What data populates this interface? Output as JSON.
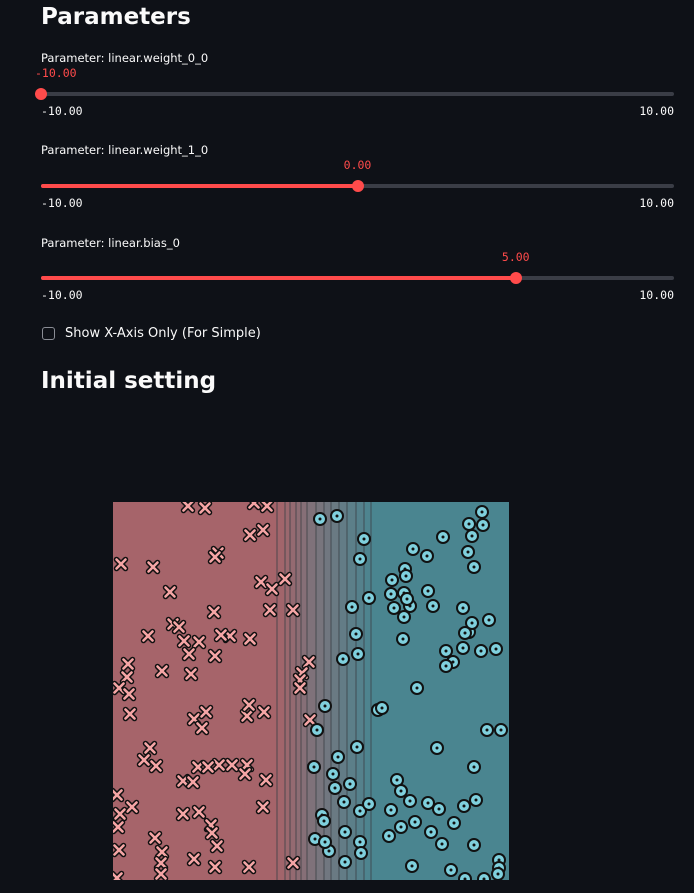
{
  "section_title": "Parameters",
  "sliders": [
    {
      "label": "Parameter: linear.weight_0_0",
      "value": -10.0,
      "value_text": "-10.00",
      "min_text": "-10.00",
      "max_text": "10.00",
      "min": -10,
      "max": 10
    },
    {
      "label": "Parameter: linear.weight_1_0",
      "value": 0.0,
      "value_text": "0.00",
      "min_text": "-10.00",
      "max_text": "10.00",
      "min": -10,
      "max": 10
    },
    {
      "label": "Parameter: linear.bias_0",
      "value": 5.0,
      "value_text": "5.00",
      "min_text": "-10.00",
      "max_text": "10.00",
      "min": -10,
      "max": 10
    }
  ],
  "checkbox": {
    "label": "Show X-Axis Only (For Simple)",
    "checked": false
  },
  "plot_title": "Initial setting",
  "colors": {
    "background": "#0e1117",
    "accent": "#ff4b4b",
    "class0_region": "#a6646a",
    "class1_region": "#4a8590",
    "class0_marker": "#f5a5a5",
    "class1_marker": "#7fd0dd"
  },
  "chart_data": {
    "type": "scatter",
    "title": "",
    "xlabel": "",
    "ylabel": "",
    "xlim": [
      0,
      396
    ],
    "ylim": [
      0,
      378
    ],
    "grid": false,
    "boundary_lines_x": [
      164,
      172,
      177,
      183,
      188,
      194,
      203,
      211,
      218,
      226,
      234,
      243,
      251,
      258
    ],
    "series": [
      {
        "marker": "x",
        "points": [
          [
            75,
            374
          ],
          [
            92,
            372
          ],
          [
            141,
            377
          ],
          [
            154,
            374
          ],
          [
            8,
            316
          ],
          [
            40,
            313
          ],
          [
            150,
            350
          ],
          [
            137,
            345
          ],
          [
            105,
            327
          ],
          [
            102,
            323
          ],
          [
            148,
            298
          ],
          [
            172,
            301
          ],
          [
            159,
            291
          ],
          [
            57,
            288
          ],
          [
            180,
            270
          ],
          [
            157,
            270
          ],
          [
            101,
            268
          ],
          [
            35,
            244
          ],
          [
            60,
            256
          ],
          [
            66,
            253
          ],
          [
            117,
            244
          ],
          [
            137,
            241
          ],
          [
            108,
            245
          ],
          [
            86,
            238
          ],
          [
            71,
            239
          ],
          [
            102,
            224
          ],
          [
            76,
            226
          ],
          [
            78,
            206
          ],
          [
            15,
            216
          ],
          [
            49,
            209
          ],
          [
            196,
            218
          ],
          [
            189,
            207
          ],
          [
            187,
            200
          ],
          [
            187,
            192
          ],
          [
            14,
            203
          ],
          [
            6,
            192
          ],
          [
            16,
            186
          ],
          [
            17,
            166
          ],
          [
            81,
            161
          ],
          [
            134,
            164
          ],
          [
            93,
            168
          ],
          [
            151,
            168
          ],
          [
            136,
            175
          ],
          [
            197,
            160
          ],
          [
            89,
            152
          ],
          [
            37,
            132
          ],
          [
            31,
            120
          ],
          [
            43,
            114
          ],
          [
            85,
            113
          ],
          [
            134,
            115
          ],
          [
            119,
            115
          ],
          [
            106,
            115
          ],
          [
            95,
            113
          ],
          [
            132,
            106
          ],
          [
            153,
            100
          ],
          [
            70,
            99
          ],
          [
            80,
            98
          ],
          [
            150,
            73
          ],
          [
            4,
            85
          ],
          [
            19,
            73
          ],
          [
            7,
            66
          ],
          [
            70,
            66
          ],
          [
            86,
            68
          ],
          [
            98,
            55
          ],
          [
            5,
            53
          ],
          [
            99,
            47
          ],
          [
            42,
            42
          ],
          [
            6,
            30
          ],
          [
            49,
            28
          ],
          [
            104,
            34
          ],
          [
            48,
            17
          ],
          [
            81,
            21
          ],
          [
            136,
            13
          ],
          [
            180,
            17
          ],
          [
            48,
            6
          ],
          [
            102,
            13
          ],
          [
            4,
            2
          ]
        ]
      },
      {
        "marker": "o",
        "points": [
          [
            207,
            361
          ],
          [
            224,
            364
          ],
          [
            251,
            341
          ],
          [
            247,
            321
          ],
          [
            292,
            311
          ],
          [
            314,
            324
          ],
          [
            330,
            343
          ],
          [
            359,
            344
          ],
          [
            370,
            355
          ],
          [
            369,
            368
          ],
          [
            356,
            356
          ],
          [
            355,
            328
          ],
          [
            361,
            313
          ],
          [
            300,
            331
          ],
          [
            315,
            289
          ],
          [
            293,
            304
          ],
          [
            256,
            282
          ],
          [
            239,
            273
          ],
          [
            278,
            286
          ],
          [
            279,
            300
          ],
          [
            291,
            287
          ],
          [
            297,
            274
          ],
          [
            294,
            281
          ],
          [
            281,
            272
          ],
          [
            320,
            274
          ],
          [
            291,
            263
          ],
          [
            350,
            272
          ],
          [
            356,
            248
          ],
          [
            290,
            241
          ],
          [
            352,
            247
          ],
          [
            359,
            257
          ],
          [
            350,
            232
          ],
          [
            376,
            260
          ],
          [
            243,
            246
          ],
          [
            368,
            229
          ],
          [
            383,
            231
          ],
          [
            245,
            226
          ],
          [
            230,
            221
          ],
          [
            333,
            229
          ],
          [
            340,
            218
          ],
          [
            333,
            214
          ],
          [
            304,
            192
          ],
          [
            212,
            174
          ],
          [
            265,
            170
          ],
          [
            269,
            172
          ],
          [
            374,
            150
          ],
          [
            388,
            150
          ],
          [
            204,
            150
          ],
          [
            324,
            132
          ],
          [
            244,
            133
          ],
          [
            225,
            123
          ],
          [
            201,
            113
          ],
          [
            361,
            113
          ],
          [
            220,
            106
          ],
          [
            237,
            96
          ],
          [
            284,
            100
          ],
          [
            288,
            89
          ],
          [
            297,
            79
          ],
          [
            222,
            92
          ],
          [
            247,
            69
          ],
          [
            231,
            78
          ],
          [
            209,
            65
          ],
          [
            315,
            77
          ],
          [
            326,
            71
          ],
          [
            302,
            58
          ],
          [
            351,
            74
          ],
          [
            363,
            80
          ],
          [
            256,
            76
          ],
          [
            211,
            59
          ],
          [
            232,
            48
          ],
          [
            202,
            41
          ],
          [
            247,
            38
          ],
          [
            361,
            35
          ],
          [
            386,
            20
          ],
          [
            386,
            12
          ],
          [
            338,
            10
          ],
          [
            352,
            1
          ],
          [
            276,
            44
          ],
          [
            288,
            53
          ],
          [
            341,
            57
          ],
          [
            318,
            48
          ],
          [
            248,
            27
          ],
          [
            232,
            18
          ],
          [
            216,
            29
          ],
          [
            212,
            38
          ],
          [
            278,
            70
          ],
          [
            329,
            36
          ],
          [
            299,
            14
          ],
          [
            385,
            6
          ],
          [
            371,
            1
          ]
        ]
      }
    ]
  }
}
